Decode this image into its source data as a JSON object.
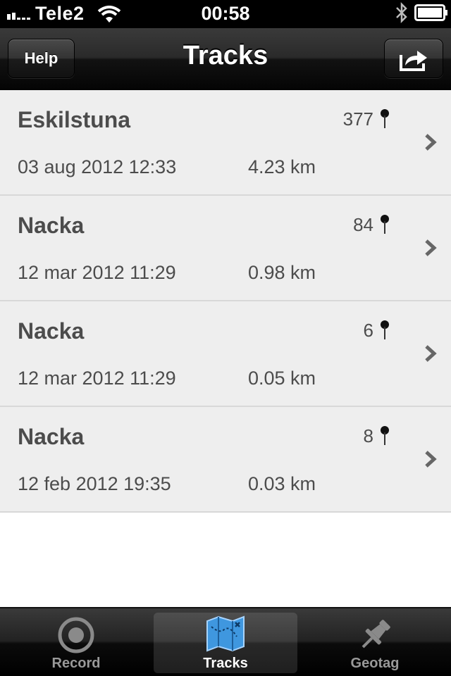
{
  "status_bar": {
    "carrier": "Tele2",
    "time": "00:58"
  },
  "nav": {
    "title": "Tracks",
    "help_label": "Help"
  },
  "tracks": [
    {
      "name": "Eskilstuna",
      "count": "377",
      "date": "03 aug 2012 12:33",
      "distance": "4.23 km"
    },
    {
      "name": "Nacka",
      "count": "84",
      "date": "12 mar 2012 11:29",
      "distance": "0.98 km"
    },
    {
      "name": "Nacka",
      "count": "6",
      "date": "12 mar 2012 11:29",
      "distance": "0.05 km"
    },
    {
      "name": "Nacka",
      "count": "8",
      "date": "12 feb 2012 19:35",
      "distance": "0.03 km"
    }
  ],
  "tabs": [
    {
      "label": "Record",
      "icon": "record-icon",
      "selected": false
    },
    {
      "label": "Tracks",
      "icon": "map-icon",
      "selected": true
    },
    {
      "label": "Geotag",
      "icon": "pushpin-icon",
      "selected": false
    }
  ],
  "colors": {
    "row_background": "#eeeeee",
    "row_text": "#4c4c4c",
    "bar_dark": "#000000"
  }
}
